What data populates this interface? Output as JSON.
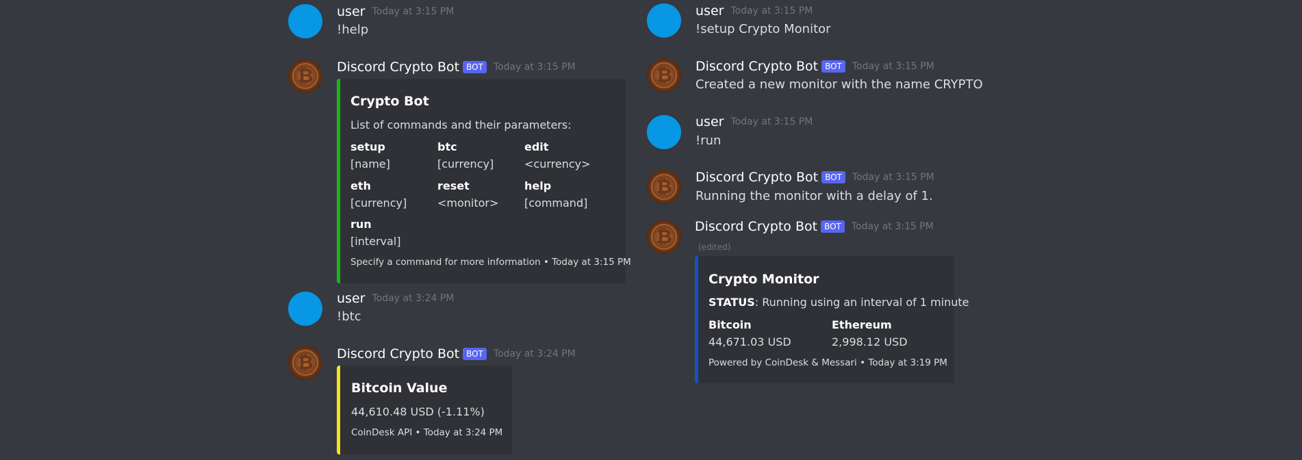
{
  "users": {
    "user_name": "user",
    "bot_name": "Discord Crypto Bot",
    "bot_badge": "BOT"
  },
  "left": {
    "msg1": {
      "time": "Today at 3:15 PM",
      "text": "!help"
    },
    "msg2": {
      "time": "Today at 3:15 PM",
      "embed": {
        "color": "#17b51c",
        "title": "Crypto Bot",
        "description": "List of commands and their parameters:",
        "fields": [
          {
            "name": "setup",
            "value": "[name]"
          },
          {
            "name": "btc",
            "value": "[currency]"
          },
          {
            "name": "edit",
            "value": "<currency>"
          },
          {
            "name": "eth",
            "value": "[currency]"
          },
          {
            "name": "reset",
            "value": "<monitor>"
          },
          {
            "name": "help",
            "value": "[command]"
          },
          {
            "name": "run",
            "value": "[interval]"
          }
        ],
        "footer": "Specify a command for more information • Today at 3:15 PM"
      }
    },
    "msg3": {
      "time": "Today at 3:24 PM",
      "text": "!btc"
    },
    "msg4": {
      "time": "Today at 3:24 PM",
      "embed": {
        "color": "#f5e21b",
        "title": "Bitcoin Value",
        "description": "44,610.48 USD (-1.11%)",
        "footer": "CoinDesk API • Today at 3:24 PM"
      }
    }
  },
  "right": {
    "msg1": {
      "time": "Today at 3:15 PM",
      "text": "!setup Crypto Monitor"
    },
    "msg2": {
      "time": "Today at 3:15 PM",
      "text": "Created a new monitor with the name CRYPTO"
    },
    "msg3": {
      "time": "Today at 3:15 PM",
      "text": "!run"
    },
    "msg4": {
      "time": "Today at 3:15 PM",
      "text": "Running the monitor with a delay of 1."
    },
    "msg5": {
      "time": "Today at 3:15 PM",
      "edited": "(edited)",
      "embed": {
        "color": "#1551c4",
        "title": "Crypto Monitor",
        "status_label": "STATUS",
        "status_text": ": Running using an interval of 1 minute",
        "fields": [
          {
            "name": "Bitcoin",
            "value": "44,671.03 USD"
          },
          {
            "name": "Ethereum",
            "value": "2,998.12 USD"
          }
        ],
        "footer": "Powered by CoinDesk & Messari • Today at 3:19 PM"
      }
    }
  },
  "icons": {
    "user_avatar": "user-avatar-icon",
    "bot_avatar": "bitcoin-avatar-icon",
    "coin_glyph": "₿"
  }
}
